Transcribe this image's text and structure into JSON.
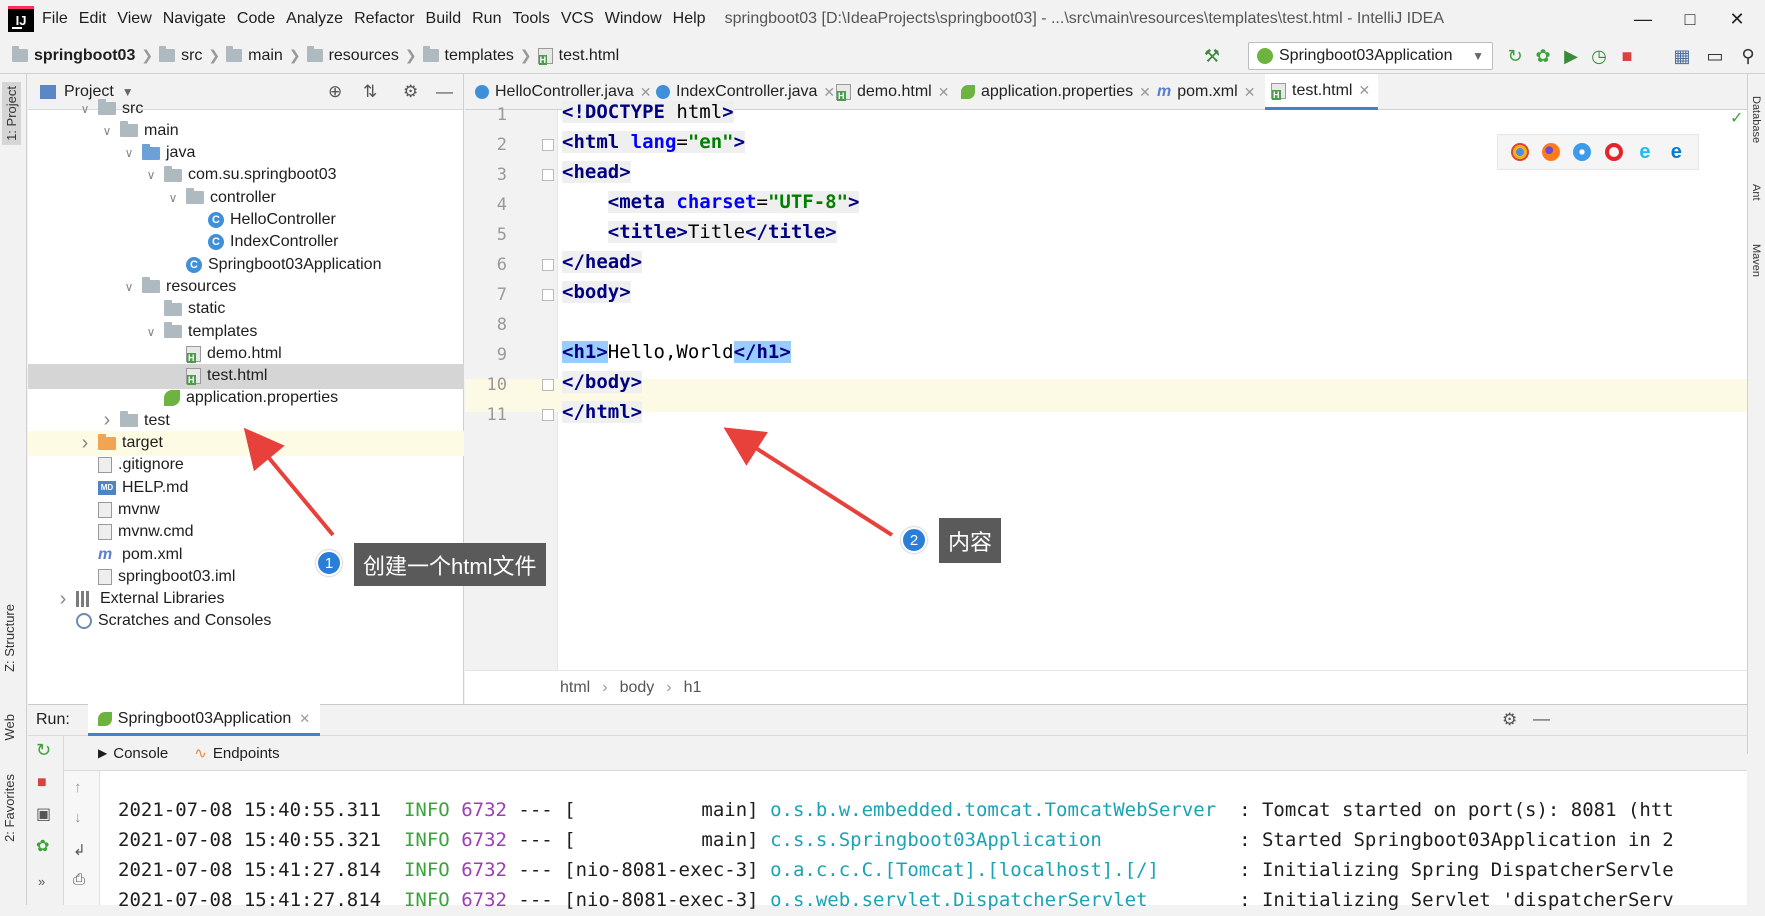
{
  "menu": {
    "logo": "IJ",
    "items": [
      "File",
      "Edit",
      "View",
      "Navigate",
      "Code",
      "Analyze",
      "Refactor",
      "Build",
      "Run",
      "Tools",
      "VCS",
      "Window",
      "Help"
    ],
    "title": "springboot03 [D:\\IdeaProjects\\springboot03] - ...\\src\\main\\resources\\templates\\test.html - IntelliJ IDEA"
  },
  "navbar": {
    "crumbs": [
      "springboot03",
      "src",
      "main",
      "resources",
      "templates",
      "test.html"
    ],
    "run_config": "Springboot03Application"
  },
  "left_stripe": {
    "project": "1: Project",
    "structure": "Z: Structure",
    "web": "Web",
    "favorites": "2: Favorites"
  },
  "right_stripe": {
    "database": "Database",
    "ant": "Ant",
    "maven": "Maven"
  },
  "project_panel": {
    "title": "Project",
    "tree": [
      {
        "label": "src",
        "icon": "folder"
      },
      {
        "label": "main",
        "icon": "folder"
      },
      {
        "label": "java",
        "icon": "folder-source"
      },
      {
        "label": "com.su.springboot03",
        "icon": "package"
      },
      {
        "label": "controller",
        "icon": "package"
      },
      {
        "label": "HelloController",
        "icon": "class"
      },
      {
        "label": "IndexController",
        "icon": "class"
      },
      {
        "label": "Springboot03Application",
        "icon": "spring-class"
      },
      {
        "label": "resources",
        "icon": "folder-resources"
      },
      {
        "label": "static",
        "icon": "folder"
      },
      {
        "label": "templates",
        "icon": "folder"
      },
      {
        "label": "demo.html",
        "icon": "html"
      },
      {
        "label": "test.html",
        "icon": "html"
      },
      {
        "label": "application.properties",
        "icon": "spring-properties"
      },
      {
        "label": "test",
        "icon": "folder"
      },
      {
        "label": "target",
        "icon": "folder-excluded"
      },
      {
        "label": ".gitignore",
        "icon": "file"
      },
      {
        "label": "HELP.md",
        "icon": "markdown"
      },
      {
        "label": "mvnw",
        "icon": "file"
      },
      {
        "label": "mvnw.cmd",
        "icon": "file"
      },
      {
        "label": "pom.xml",
        "icon": "maven"
      },
      {
        "label": "springboot03.iml",
        "icon": "module"
      },
      {
        "label": "External Libraries",
        "icon": "library"
      },
      {
        "label": "Scratches and Consoles",
        "icon": "scratch"
      }
    ]
  },
  "editor_tabs": [
    "HelloController.java",
    "IndexController.java",
    "demo.html",
    "application.properties",
    "pom.xml",
    "test.html"
  ],
  "editor": {
    "line_numbers": [
      "1",
      "2",
      "3",
      "4",
      "5",
      "6",
      "7",
      "8",
      "9",
      "10",
      "11"
    ],
    "lines": [
      "<!DOCTYPE html>",
      "<html lang=\"en\">",
      "<head>",
      "    <meta charset=\"UTF-8\">",
      "    <title>Title</title>",
      "</head>",
      "<body>",
      "",
      "<h1>Hello,World</h1>",
      "</body>",
      "</html>"
    ]
  },
  "code_breadcrumb": [
    "html",
    "body",
    "h1"
  ],
  "run_panel": {
    "label": "Run:",
    "tab": "Springboot03Application",
    "console_tab": "Console",
    "endpoints_tab": "Endpoints",
    "logs": [
      {
        "ts": "2021-07-08 15:40:55.311",
        "level": "INFO",
        "pid": "6732",
        "sep": "---",
        "thread": "[           main]",
        "cls": "o.s.b.w.embedded.tomcat.TomcatWebServer ",
        "msg": " : Tomcat started on port(s): 8081 (htt"
      },
      {
        "ts": "2021-07-08 15:40:55.321",
        "level": "INFO",
        "pid": "6732",
        "sep": "---",
        "thread": "[           main]",
        "cls": "c.s.s.Springboot03Application           ",
        "msg": " : Started Springboot03Application in 2"
      },
      {
        "ts": "2021-07-08 15:41:27.814",
        "level": "INFO",
        "pid": "6732",
        "sep": "---",
        "thread": "[nio-8081-exec-3]",
        "cls": "o.a.c.c.C.[Tomcat].[localhost].[/]      ",
        "msg": " : Initializing Spring DispatcherServle"
      },
      {
        "ts": "2021-07-08 15:41:27.814",
        "level": "INFO",
        "pid": "6732",
        "sep": "---",
        "thread": "[nio-8081-exec-3]",
        "cls": "o.s.web.servlet.DispatcherServlet       ",
        "msg": " : Initializing Servlet 'dispatcherServ"
      }
    ]
  },
  "annotations": [
    {
      "number": "1",
      "text": "创建一个html文件"
    },
    {
      "number": "2",
      "text": "内容"
    }
  ],
  "colors": {
    "accent": "#4083c9",
    "annotation_arrow": "#e8403a",
    "annotation_badge": "#2b7ed8"
  }
}
